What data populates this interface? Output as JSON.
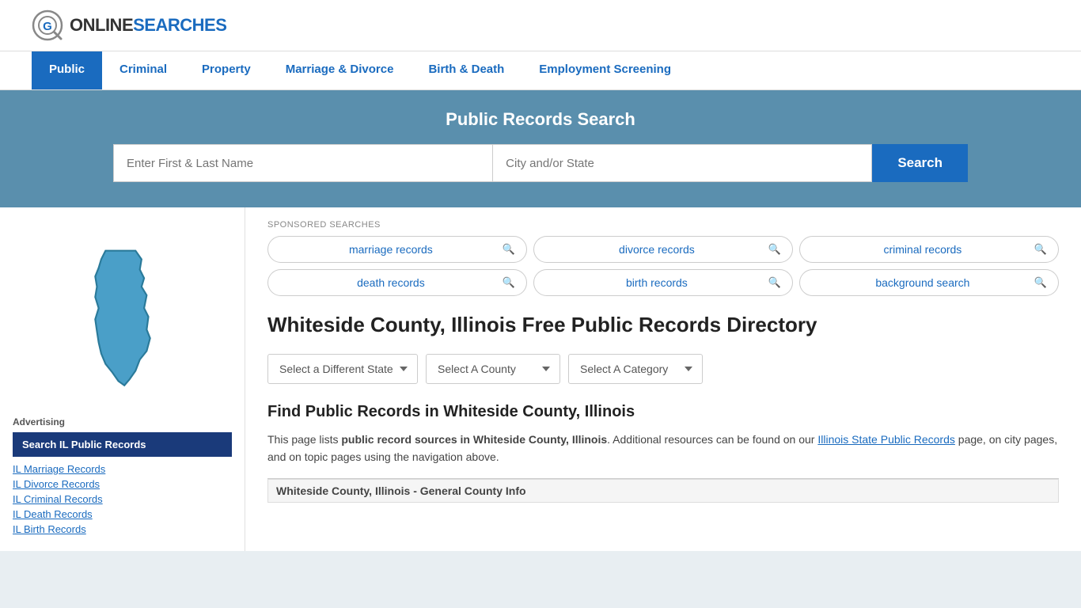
{
  "logo": {
    "online": "ONLINE",
    "searches": "SEARCHES"
  },
  "nav": {
    "items": [
      {
        "label": "Public",
        "active": true
      },
      {
        "label": "Criminal",
        "active": false
      },
      {
        "label": "Property",
        "active": false
      },
      {
        "label": "Marriage & Divorce",
        "active": false
      },
      {
        "label": "Birth & Death",
        "active": false
      },
      {
        "label": "Employment Screening",
        "active": false
      }
    ]
  },
  "hero": {
    "title": "Public Records Search",
    "name_placeholder": "Enter First & Last Name",
    "city_placeholder": "City and/or State",
    "search_label": "Search"
  },
  "sponsored": {
    "label": "SPONSORED SEARCHES",
    "pills": [
      {
        "text": "marriage records"
      },
      {
        "text": "divorce records"
      },
      {
        "text": "criminal records"
      },
      {
        "text": "death records"
      },
      {
        "text": "birth records"
      },
      {
        "text": "background search"
      }
    ]
  },
  "page": {
    "heading": "Whiteside County, Illinois Free Public Records Directory",
    "dropdown_state": "Select a Different State",
    "dropdown_county": "Select A County",
    "dropdown_category": "Select A Category",
    "find_title": "Find Public Records in Whiteside County, Illinois",
    "find_desc_1": "This page lists ",
    "find_desc_bold": "public record sources in Whiteside County, Illinois",
    "find_desc_2": ". Additional resources can be found on our ",
    "find_link": "Illinois State Public Records",
    "find_desc_3": " page, on city pages, and on topic pages using the navigation above.",
    "general_info": "Whiteside County, Illinois - General County Info"
  },
  "sidebar": {
    "advertising_label": "Advertising",
    "search_btn": "Search IL Public Records",
    "links": [
      "IL Marriage Records",
      "IL Divorce Records",
      "IL Criminal Records",
      "IL Death Records",
      "IL Birth Records"
    ]
  }
}
